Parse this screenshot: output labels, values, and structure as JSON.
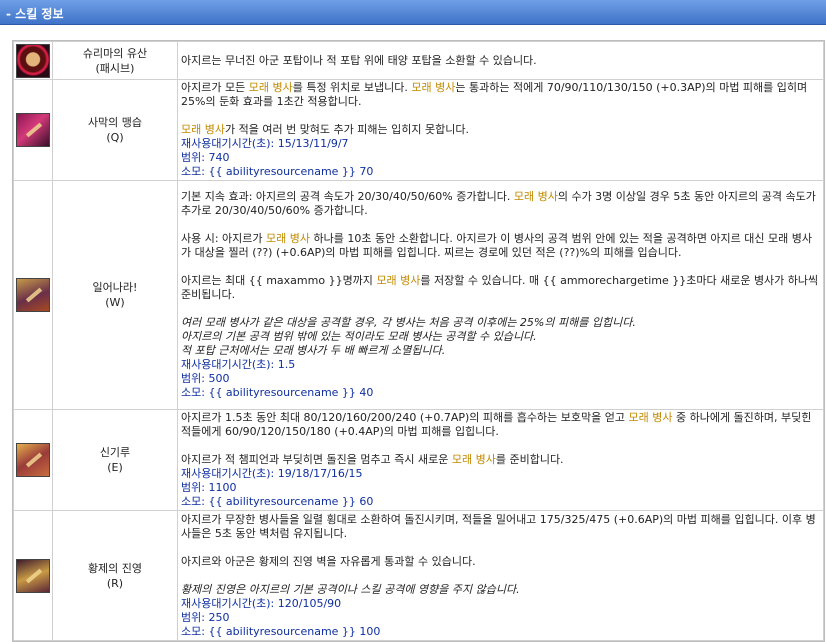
{
  "header": {
    "title": "- 스킬 정보"
  },
  "skills": [
    {
      "name": "슈리마의 유산",
      "key": "(패시브)",
      "icon": "azir-passive-icon",
      "desc": [
        "아지르는 무너진 아군 포탑이나 적 포탑 위에 태양 포탑을 소환할 수 있습니다."
      ]
    },
    {
      "name": "사막의 맹습",
      "key": "(Q)",
      "icon": "conquering-sands-icon",
      "desc": [
        "아지르가 모든 ",
        "모래 병사",
        "를 특정 위치로 보냅니다. ",
        "모래 병사",
        "는 통과하는 적에게 70/90/110/130/150 (+0.3AP)의 마법 피해를 입히며 25%의 둔화 효과를 1초간 적용합니다.",
        "모래 병사",
        "가 적을 여러 번 맞혀도 추가 피해는 입히지 못합니다."
      ],
      "cooldown": "재사용대기시간(초): 15/13/11/9/7",
      "range": "범위: 740",
      "cost": "소모: {{ abilityresourcename }} 70"
    },
    {
      "name": "일어나라!",
      "key": "(W)",
      "icon": "arise-icon",
      "desc": [
        "기본 지속 효과: 아지르의 공격 속도가 20/30/40/50/60% 증가합니다. ",
        "모래 병사",
        "의 수가 3명 이상일 경우 5초 동안 아지르의 공격 속도가 추가로 20/30/40/50/60% 증가합니다.",
        "사용 시: 아지르가 ",
        "모래 병사",
        " 하나를 10초 동안 소환합니다. 아지르가 이 병사의 공격 범위 안에 있는 적을 공격하면 아지르 대신 모래 병사가 대상을 찔러 (??) (+0.6AP)의 마법 피해를 입힙니다. 찌르는 경로에 있던 적은 (??)%의 피해를 입습니다.",
        "아지르는 최대 {{ maxammo }}명까지 ",
        "모래 병사",
        "를 저장할 수 있습니다. 매 {{ ammorechargetime }}초마다 새로운 병사가 하나씩 준비됩니다.",
        "여러 모래 병사가 같은 대상을 공격할 경우, 각 병사는 처음 공격 이후에는 25%의 피해를 입힙니다.",
        "아지르의 기본 공격 범위 밖에 있는 적이라도 모래 병사는 공격할 수 있습니다.",
        "적 포탑 근처에서는 모래 병사가 두 배 빠르게 소멸됩니다."
      ],
      "cooldown": "재사용대기시간(초): 1.5",
      "range": "범위: 500",
      "cost": "소모: {{ abilityresourcename }} 40"
    },
    {
      "name": "신기루",
      "key": "(E)",
      "icon": "shifting-sands-icon",
      "desc": [
        "아지르가 1.5초 동안 최대 80/120/160/200/240 (+0.7AP)의 피해를 흡수하는 보호막을 얻고 ",
        "모래 병사",
        " 중 하나에게 돌진하며, 부딪힌 적들에게 60/90/120/150/180 (+0.4AP)의 마법 피해를 입힙니다.",
        "아지르가 적 챔피언과 부딪히면 돌진을 멈추고 즉시 새로운 ",
        "모래 병사",
        "를 준비합니다."
      ],
      "cooldown": "재사용대기시간(초): 19/18/17/16/15",
      "range": "범위: 1100",
      "cost": "소모: {{ abilityresourcename }} 60"
    },
    {
      "name": "황제의 진영",
      "key": "(R)",
      "icon": "emperors-divide-icon",
      "desc": [
        "아지르가 무장한 병사들을 일렬 횡대로 소환하여 돌진시키며, 적들을 밀어내고 175/325/475 (+0.6AP)의 마법 피해를 입힙니다. 이후 병사들은 5초 동안 벽처럼 유지됩니다.",
        "아지르와 아군은 황제의 진영 벽을 자유롭게 통과할 수 있습니다.",
        "황제의 진영은 아지르의 기본 공격이나 스킬 공격에 영향을 주지 않습니다."
      ],
      "cooldown": "재사용대기시간(초): 120/105/90",
      "range": "범위: 250",
      "cost": "소모: {{ abilityresourcename }} 100"
    }
  ]
}
